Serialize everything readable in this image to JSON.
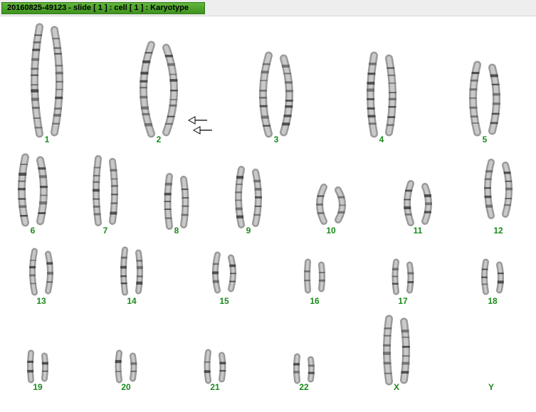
{
  "window": {
    "title": "20160825-49123 - slide [ 1 ] : cell [ 1 ] : Karyotype"
  },
  "colors": {
    "title_bg": "#4fa72d",
    "label": "#1a8a1a",
    "chromosome": "#8a8a8a",
    "band": "#2a2a2a"
  },
  "icons": [
    "arrow-left-icon",
    "arrow-left-icon"
  ],
  "karyotype": {
    "labels": [
      "1",
      "2",
      "3",
      "4",
      "5",
      "6",
      "7",
      "8",
      "9",
      "10",
      "11",
      "12",
      "13",
      "14",
      "15",
      "16",
      "17",
      "18",
      "19",
      "20",
      "21",
      "22",
      "X",
      "Y"
    ]
  }
}
